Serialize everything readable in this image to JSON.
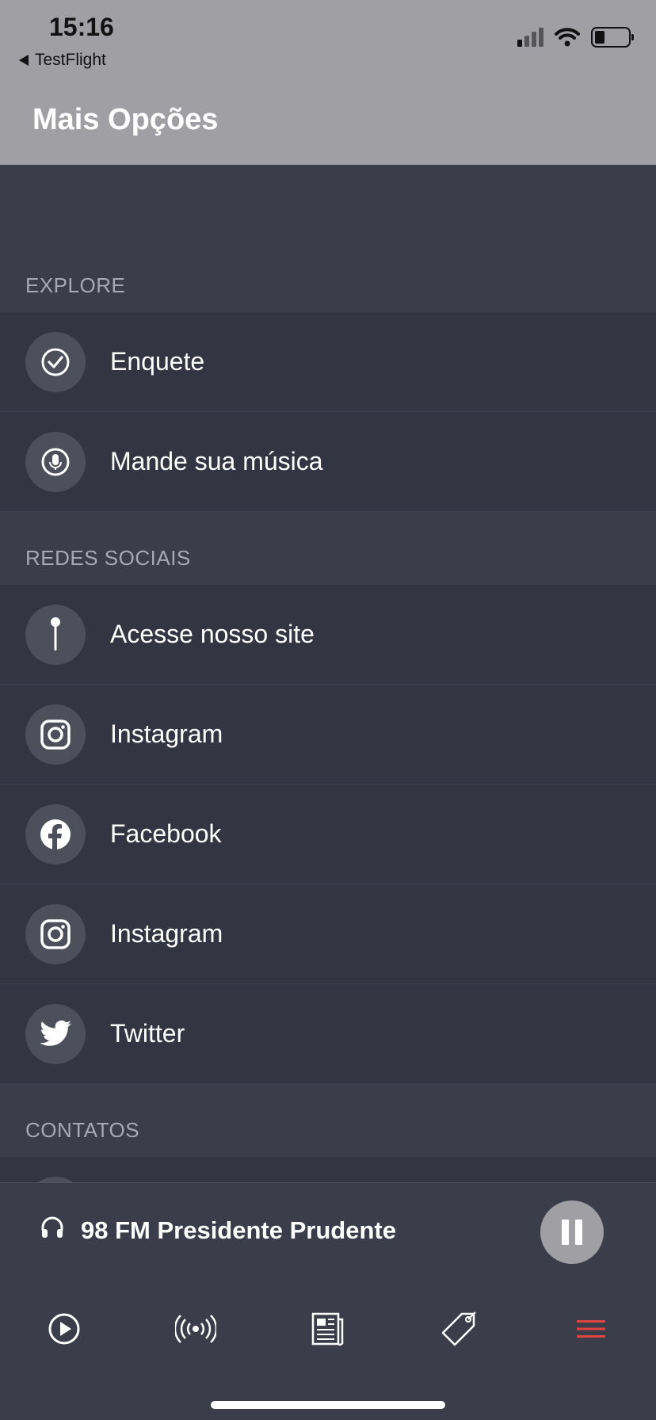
{
  "status_bar": {
    "time": "15:16",
    "back_app": "TestFlight"
  },
  "header": {
    "title": "Mais Opções"
  },
  "sections": [
    {
      "title": "EXPLORE",
      "items": [
        {
          "label": "Enquete",
          "icon": "check-circle-icon"
        },
        {
          "label": "Mande sua música",
          "icon": "microphone-icon"
        }
      ]
    },
    {
      "title": "REDES SOCIAIS",
      "items": [
        {
          "label": "Acesse nosso site",
          "icon": "pin-icon"
        },
        {
          "label": "Instagram",
          "icon": "instagram-icon"
        },
        {
          "label": "Facebook",
          "icon": "facebook-icon"
        },
        {
          "label": "Instagram",
          "icon": "instagram-icon"
        },
        {
          "label": "Twitter",
          "icon": "twitter-icon"
        }
      ]
    },
    {
      "title": "CONTATOS",
      "items": []
    }
  ],
  "player": {
    "station": "98 FM Presidente Prudente",
    "state_icon": "pause-icon"
  },
  "tabbar": {
    "tabs": [
      {
        "icon": "play-circle-icon",
        "active": false
      },
      {
        "icon": "broadcast-icon",
        "active": false
      },
      {
        "icon": "news-icon",
        "active": false
      },
      {
        "icon": "tag-icon",
        "active": false
      },
      {
        "icon": "menu-icon",
        "active": true
      }
    ],
    "active_color": "#e0443f"
  }
}
